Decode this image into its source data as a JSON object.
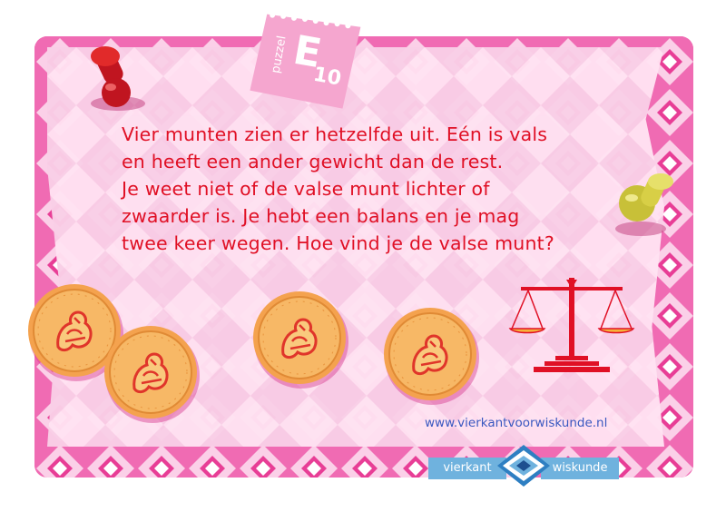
{
  "puzzle": {
    "word": "puzzel",
    "letter": "E",
    "number": "10"
  },
  "question_lines": [
    "Vier munten zien er hetzelfde uit. Eén is vals",
    "en heeft een ander gewicht dan de rest.",
    "Je weet niet of de valse munt lichter of",
    "zwaarder is. Je hebt een balans en je mag",
    "twee keer wegen. Hoe vind je de valse munt?"
  ],
  "url": "www.vierkantvoorwiskunde.nl",
  "logo": {
    "left": "vierkant",
    "right": "wiskunde"
  },
  "icons": {
    "pin_red": "red-push-pin-icon",
    "pin_yellow": "yellow-push-pin-icon",
    "coin": "euro-coin-icon",
    "scale": "balance-scale-icon"
  },
  "colors": {
    "card": "#e95aa8",
    "text": "#e01025",
    "link": "#3a58c0",
    "logo_bar": "#6fb2de"
  }
}
